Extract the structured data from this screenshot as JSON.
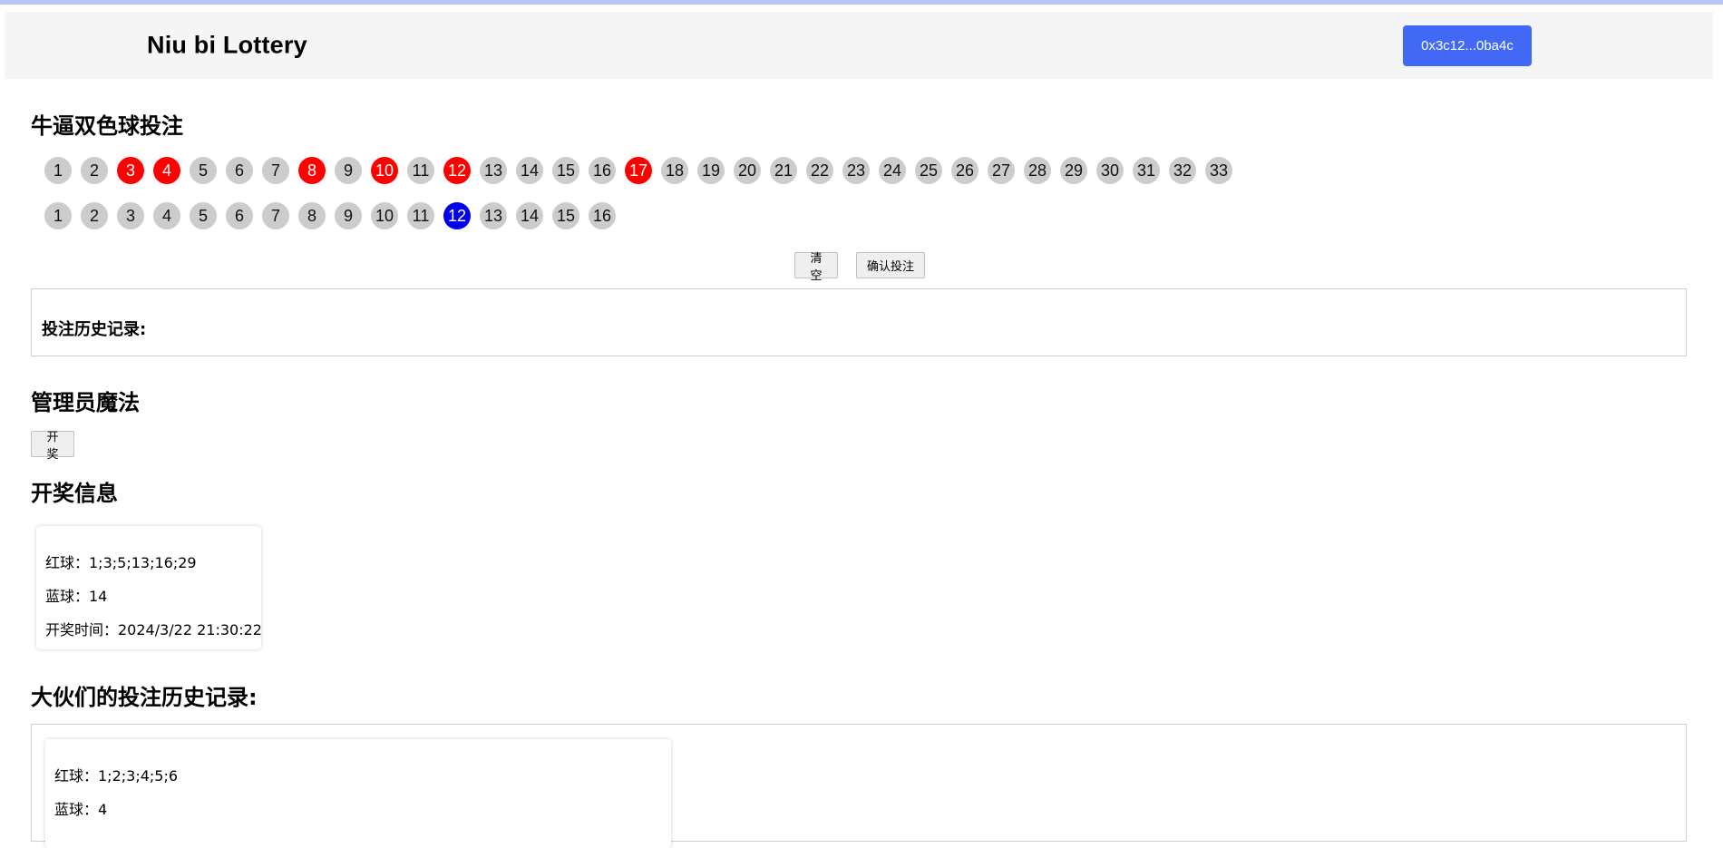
{
  "header": {
    "title": "Niu bi Lottery",
    "wallet_label": "0x3c12...0ba4c"
  },
  "betting": {
    "title": "牛逼双色球投注",
    "red_balls": [
      "1",
      "2",
      "3",
      "4",
      "5",
      "6",
      "7",
      "8",
      "9",
      "10",
      "11",
      "12",
      "13",
      "14",
      "15",
      "16",
      "17",
      "18",
      "19",
      "20",
      "21",
      "22",
      "23",
      "24",
      "25",
      "26",
      "27",
      "28",
      "29",
      "30",
      "31",
      "32",
      "33"
    ],
    "red_selected": [
      "3",
      "4",
      "8",
      "10",
      "12",
      "17"
    ],
    "blue_balls": [
      "1",
      "2",
      "3",
      "4",
      "5",
      "6",
      "7",
      "8",
      "9",
      "10",
      "11",
      "12",
      "13",
      "14",
      "15",
      "16"
    ],
    "blue_selected": [
      "12"
    ],
    "clear_label": "清空",
    "confirm_label": "确认投注",
    "history_label": "投注历史记录:"
  },
  "admin": {
    "title": "管理员魔法",
    "draw_label": "开奖"
  },
  "draw_info": {
    "title": "开奖信息",
    "red_line": "红球：1;3;5;13;16;29",
    "blue_line": "蓝球：14",
    "time_line": "开奖时间：2024/3/22 21:30:22"
  },
  "public_history": {
    "title": "大伙们的投注历史记录:",
    "entries": [
      {
        "red_line": "红球：1;2;3;4;5;6",
        "blue_line": "蓝球：4"
      }
    ]
  },
  "colors": {
    "accent": "#4169f5",
    "red_selected": "#ff0000",
    "blue_selected": "#0000ee",
    "ball_default": "#cccccc"
  }
}
